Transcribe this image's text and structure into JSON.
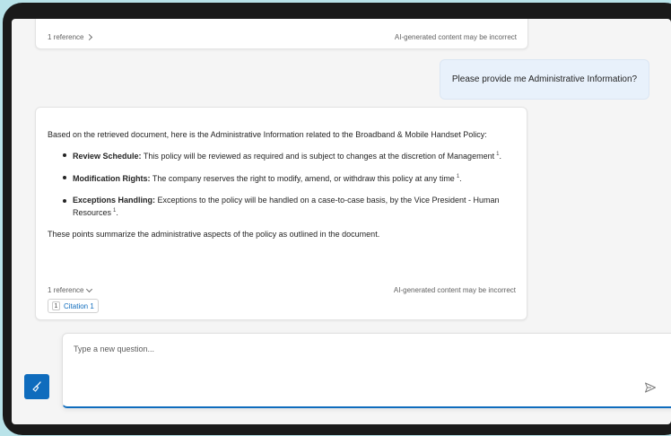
{
  "top_card": {
    "reference_label": "1 reference",
    "disclaimer": "AI-generated content may be incorrect"
  },
  "user_message": "Please provide me Administrative Information?",
  "answer": {
    "intro": "Based on the retrieved document, here is the Administrative Information related to the Broadband & Mobile Handset Policy:",
    "items": [
      {
        "title": "Review Schedule",
        "separator": ":",
        "text": " This policy will be reviewed as required and is subject to changes at the discretion of Management",
        "citation": "1",
        "end": "."
      },
      {
        "title": "Modification Rights",
        "separator": ":",
        "text": " The company reserves the right to modify, amend, or withdraw this policy at any time",
        "citation": "1",
        "end": "."
      },
      {
        "title": "Exceptions Handling",
        "separator": ":",
        "text": " Exceptions to the policy will be handled on a case-to-case basis, by the Vice President - Human Resources",
        "citation": "1",
        "end": "."
      }
    ],
    "summary": "These points summarize the administrative aspects of the policy as outlined in the document.",
    "reference_label": "1 reference",
    "disclaimer": "AI-generated content may be incorrect",
    "citation_chip": {
      "number": "1",
      "label": "Citation 1"
    }
  },
  "input": {
    "placeholder": "Type a new question..."
  },
  "icons": {
    "new_chat": "broom-icon",
    "send": "send-icon",
    "chevron_right": "chevron-right-icon",
    "chevron_down": "chevron-down-icon"
  },
  "colors": {
    "accent": "#0f6cbd",
    "user_bubble": "#e8f1fb",
    "background": "#f5f5f5",
    "backdrop": "#b9e3e9"
  }
}
